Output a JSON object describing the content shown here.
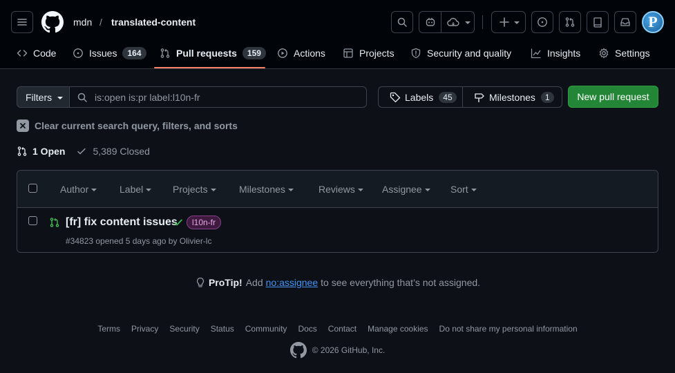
{
  "header": {
    "owner": "mdn",
    "separator": "/",
    "repo": "translated-content",
    "avatar_letter": "P"
  },
  "tabs": [
    {
      "label": "Code",
      "icon": "code-icon"
    },
    {
      "label": "Issues",
      "count": "164",
      "icon": "issue-icon"
    },
    {
      "label": "Pull requests",
      "count": "159",
      "icon": "git-pull-request-icon",
      "selected": true
    },
    {
      "label": "Actions",
      "icon": "play-icon"
    },
    {
      "label": "Projects",
      "icon": "table-icon"
    },
    {
      "label": "Security and quality",
      "icon": "shield-icon"
    },
    {
      "label": "Insights",
      "icon": "graph-icon"
    },
    {
      "label": "Settings",
      "icon": "gear-icon"
    }
  ],
  "filter_bar": {
    "filters_label": "Filters",
    "search_value": "is:open is:pr label:l10n-fr",
    "labels_label": "Labels",
    "labels_count": "45",
    "milestones_label": "Milestones",
    "milestones_count": "1",
    "new_pr_label": "New pull request"
  },
  "clear_label": "Clear current search query, filters, and sorts",
  "states": {
    "open": "1 Open",
    "closed": "5,389 Closed"
  },
  "list_header": {
    "filters": [
      "Author",
      "Label",
      "Projects",
      "Milestones",
      "Reviews",
      "Assignee",
      "Sort"
    ]
  },
  "pull_requests": [
    {
      "title": "[fr] fix content issues",
      "label": "l10n-fr",
      "meta": "#34823 opened 5 days ago by Olivier-lc",
      "status": "success"
    }
  ],
  "protip": {
    "prefix": "ProTip!",
    "pre_text": "Add",
    "link": "no:assignee",
    "post_text": "to see everything that’s not assigned."
  },
  "footer": {
    "links": [
      "Terms",
      "Privacy",
      "Security",
      "Status",
      "Community",
      "Docs",
      "Contact",
      "Manage cookies",
      "Do not share my personal information"
    ],
    "copyright": "© 2026 GitHub, Inc."
  },
  "colors": {
    "background": "#0d1117",
    "header_bg": "#010409",
    "accent_underline": "#f78166",
    "primary_button": "#238636",
    "link": "#4493f8",
    "open_green": "#3fb950",
    "label_purple": "#e7a6e7"
  }
}
